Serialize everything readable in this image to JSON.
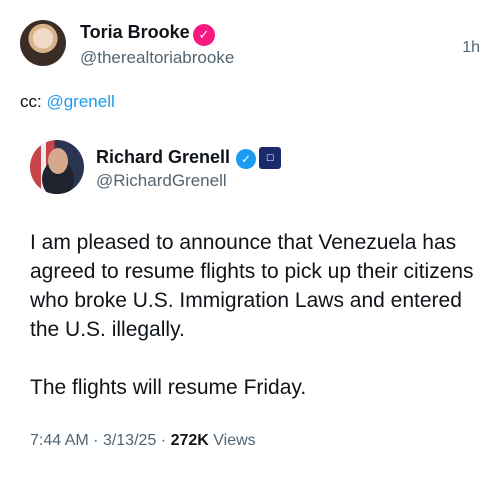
{
  "quote_tweet": {
    "author_name": "Toria Brooke",
    "author_handle": "@therealtoriabrooke",
    "time_ago": "1h",
    "text_prefix": "cc:",
    "mention": "@grenell",
    "verified_color": "#f91880"
  },
  "original_tweet": {
    "author_name": "Richard Grenell",
    "author_handle": "@RichardGrenell",
    "badge_icon": "affiliate-badge-icon",
    "body_paragraphs": [
      "I am pleased to announce that Venezuela has agreed to resume flights to pick up their citizens who broke U.S. Immigration Laws and entered the U.S. illegally.",
      "The flights will resume Friday."
    ],
    "time": "7:44 AM",
    "date": "3/13/25",
    "views_count": "272K",
    "views_label": "Views",
    "verified_color": "#1d9bf0"
  }
}
